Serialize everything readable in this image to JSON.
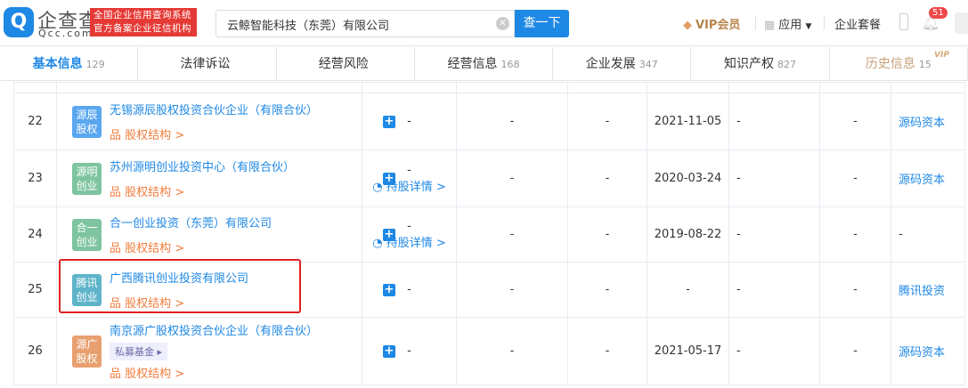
{
  "header": {
    "logo_glyph": "Q",
    "logo_name": "企查查",
    "logo_domain": "Qcc.com",
    "slogan_line1": "全国企业信用查询系统",
    "slogan_line2": "官方备案企业征信机构",
    "search_value": "云鲸智能科技（东莞）有限公司",
    "search_button": "查一下",
    "vip": "VIP会员",
    "apps": "应用",
    "package": "企业套餐",
    "notification_count": "51"
  },
  "tabs": [
    {
      "label": "基本信息",
      "count": "129"
    },
    {
      "label": "法律诉讼",
      "count": ""
    },
    {
      "label": "经营风险",
      "count": ""
    },
    {
      "label": "经营信息",
      "count": "168"
    },
    {
      "label": "企业发展",
      "count": "347"
    },
    {
      "label": "知识产权",
      "count": "827"
    },
    {
      "label": "历史信息",
      "count": "15",
      "vip": "VIP"
    }
  ],
  "common": {
    "equity_label": "股权结构 >",
    "holding_label": "持股详情 >",
    "dash": "-"
  },
  "rows": [
    {
      "num": "22",
      "tag": "源辰股权",
      "tag_color": "#5aa7f0",
      "name": "无锡源辰股权投资合伙企业（有限合伙）",
      "c3": "-",
      "c3_hold": false,
      "c4": "-",
      "c5": "-",
      "date": "2021-11-05",
      "c7": "-",
      "c8": "-",
      "investor": "源码资本"
    },
    {
      "num": "23",
      "tag": "源明创业",
      "tag_color": "#7ec4a0",
      "name": "苏州源明创业投资中心（有限合伙）",
      "c3": "-",
      "c3_hold": true,
      "c4": "-",
      "c5": "-",
      "date": "2020-03-24",
      "c7": "-",
      "c8": "-",
      "investor": "源码资本"
    },
    {
      "num": "24",
      "tag": "合一创业",
      "tag_color": "#7ec4a0",
      "name": "合一创业投资（东莞）有限公司",
      "c3": "-",
      "c3_hold": true,
      "c4": "-",
      "c5": "-",
      "date": "2019-08-22",
      "c7": "-",
      "c8": "-",
      "investor": "-"
    },
    {
      "num": "25",
      "tag": "腾讯创业",
      "tag_color": "#5eb4c8",
      "name": "广西腾讯创业投资有限公司",
      "c3": "-",
      "c3_hold": false,
      "c4": "-",
      "c5": "-",
      "date": "-",
      "c7": "-",
      "c8": "-",
      "investor": "腾讯投资"
    },
    {
      "num": "26",
      "tag": "源广股权",
      "tag_color": "#e8a070",
      "name": "南京源广股权投资合伙企业（有限合伙）",
      "badge": "私募基金 ▸",
      "c3": "-",
      "c3_hold": false,
      "c4": "-",
      "c5": "-",
      "date": "2021-05-17",
      "c7": "-",
      "c8": "-",
      "investor": "源码资本"
    }
  ]
}
